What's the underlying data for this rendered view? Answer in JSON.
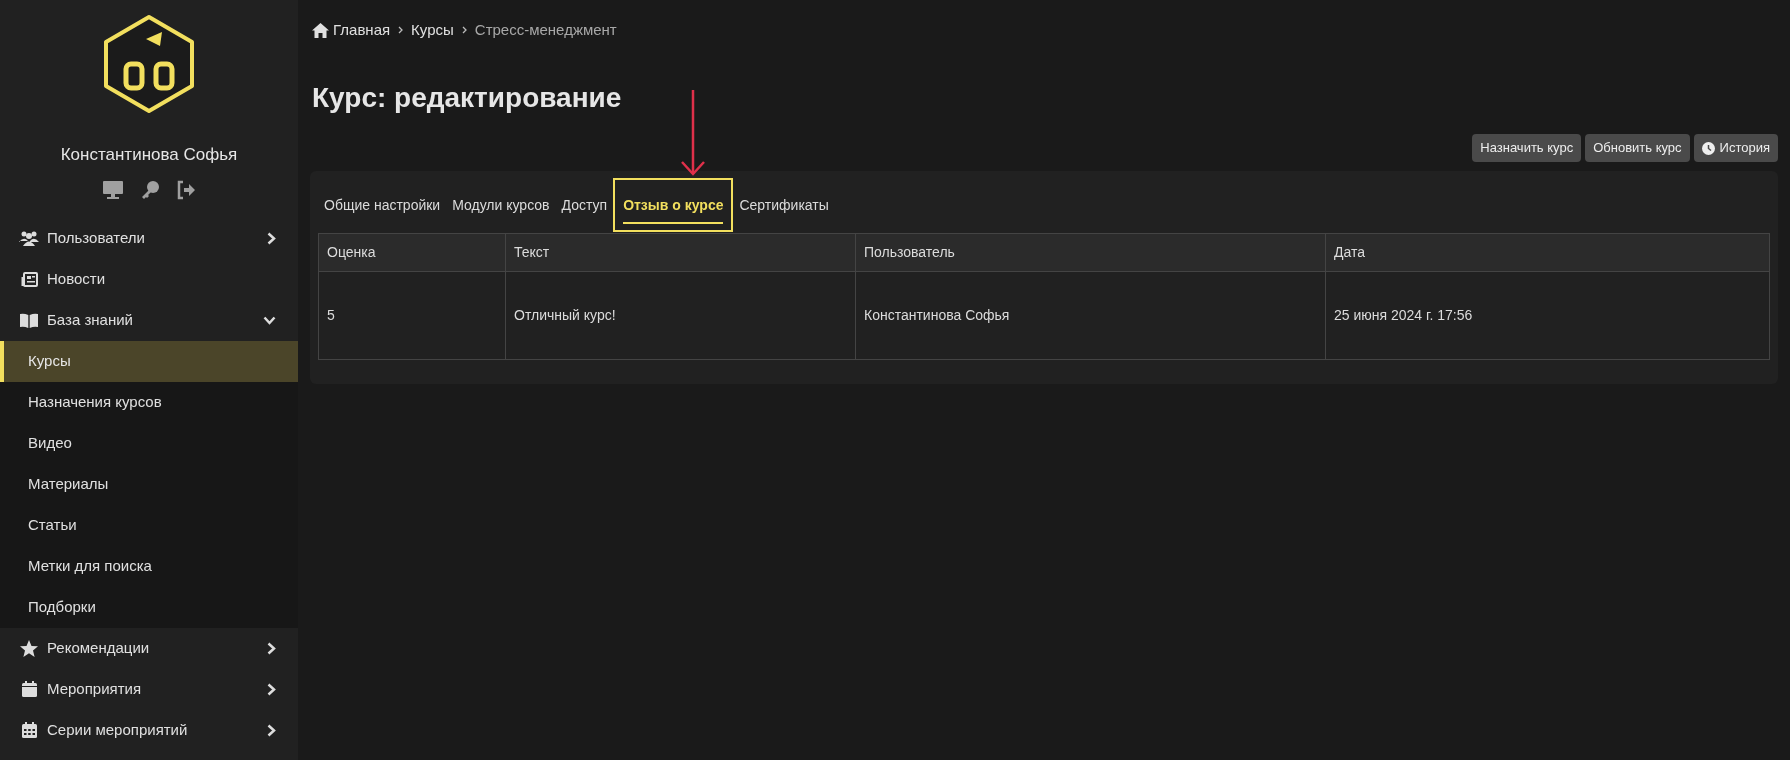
{
  "user": {
    "name": "Константинова Софья"
  },
  "sidebar": {
    "items": [
      {
        "label": "Пользователи",
        "expanded": false
      },
      {
        "label": "Новости"
      },
      {
        "label": "База знаний",
        "expanded": true,
        "children": [
          {
            "label": "Курсы",
            "selected": true
          },
          {
            "label": "Назначения курсов",
            "selected": false
          },
          {
            "label": "Видео",
            "selected": false
          },
          {
            "label": "Материалы",
            "selected": false
          },
          {
            "label": "Статьи",
            "selected": false
          },
          {
            "label": "Метки для поиска",
            "selected": false
          },
          {
            "label": "Подборки",
            "selected": false
          }
        ]
      },
      {
        "label": "Рекомендации",
        "expanded": false
      },
      {
        "label": "Мероприятия",
        "expanded": false
      },
      {
        "label": "Серии мероприятий",
        "expanded": false
      }
    ]
  },
  "breadcrumb": [
    "Главная",
    "Курсы",
    "Стресс-менеджмент"
  ],
  "title": "Курс: редактирование",
  "buttons": [
    "Назначить курс",
    "Обновить курс",
    "История"
  ],
  "tabs": [
    {
      "label": "Общие настройки",
      "selected": false
    },
    {
      "label": "Модули курсов",
      "selected": false
    },
    {
      "label": "Доступ",
      "selected": false
    },
    {
      "label": "Отзыв о курсе",
      "selected": true
    },
    {
      "label": "Сертификаты",
      "selected": false
    }
  ],
  "table": {
    "columns": [
      "Оценка",
      "Текст",
      "Пользователь",
      "Дата"
    ],
    "rows": [
      [
        "5",
        "Отличный курс!",
        "Константинова Софья",
        "25 июня 2024 г. 17:56"
      ]
    ]
  }
}
